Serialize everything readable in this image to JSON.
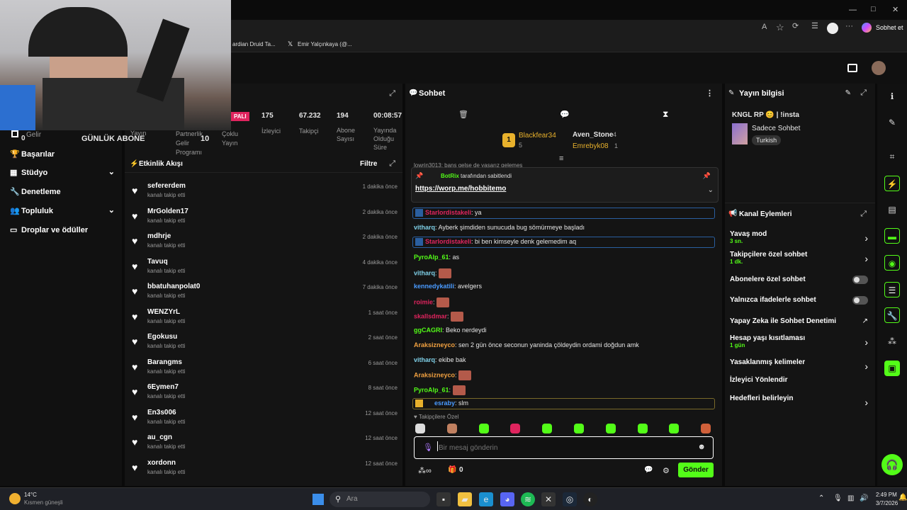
{
  "browser": {
    "window_controls": [
      "—",
      "□",
      "✕"
    ],
    "right_label": "Sobhet et",
    "bookmarks": [
      "ardian Druid Ta...",
      "Emir Yalçınkaya (@..."
    ]
  },
  "stats": {
    "badge": "PALI",
    "items": [
      {
        "value": "175",
        "label": "İzleyici"
      },
      {
        "value": "67.232",
        "label": "Takipçi"
      },
      {
        "value": "194",
        "label": "Abone Sayısı"
      },
      {
        "value": "00:08:57",
        "label": "Yayında Olduğu Süre"
      }
    ],
    "lower": {
      "gelir_zero": "0",
      "gelir_label": "Gelir",
      "yayin_label": "Yayın",
      "gunluk_abone": "GÜNLÜK ABONE",
      "partnerlik_label": "Partnerlik Gelir Programı",
      "partnerlik_value": "10",
      "coklu_label": "Çoklu Yayın"
    }
  },
  "nav": {
    "items": [
      {
        "label": "Başarılar",
        "icon": "trophy-icon"
      },
      {
        "label": "Stüdyo",
        "icon": "grid-icon",
        "chevron": true
      },
      {
        "label": "Denetleme",
        "icon": "wrench-icon"
      },
      {
        "label": "Topluluk",
        "icon": "people-icon",
        "chevron": true
      },
      {
        "label": "Droplar ve ödüller",
        "icon": "bars-icon"
      }
    ]
  },
  "events": {
    "title": "Etkinlik Akışı",
    "filter": "Filtre",
    "sub": "kanalı takip etti",
    "rows": [
      {
        "name": "sefererdem",
        "time": "1 dakika önce"
      },
      {
        "name": "MrGolden17",
        "time": "2 dakika önce"
      },
      {
        "name": "mdhrje",
        "time": "2 dakika önce"
      },
      {
        "name": "Tavuq",
        "time": "4 dakika önce"
      },
      {
        "name": "bbatuhanpolat0",
        "time": "7 dakika önce"
      },
      {
        "name": "WENZYrL",
        "time": "1 saat önce"
      },
      {
        "name": "Egokusu",
        "time": "2 saat önce"
      },
      {
        "name": "Barangms",
        "time": "6 saat önce"
      },
      {
        "name": "6Eymen7",
        "time": "8 saat önce"
      },
      {
        "name": "En3s006",
        "time": "12 saat önce"
      },
      {
        "name": "au_cgn",
        "time": "12 saat önce"
      },
      {
        "name": "xordonn",
        "time": "12 saat önce"
      }
    ]
  },
  "chat": {
    "title": "Sohbet",
    "top_users": [
      {
        "name": "Blackfear34",
        "count": "5",
        "color": "#e8b12c"
      },
      {
        "name": "Aven_Stone",
        "count": "4",
        "color": "#ffffff"
      },
      {
        "name": "Emrebyk08",
        "count": "1",
        "color": "#e8b12c"
      }
    ],
    "cut_line": "lowrin3013: banş gelse de yaşarız gelemes",
    "pinned": {
      "by": "BotRix",
      "by_suffix": "tarafından sabitlendi",
      "link": "https://worp.me/hobbitemo"
    },
    "messages": [
      {
        "user": "Starlordistakeli",
        "text": ": ya",
        "color": "#e0245e",
        "boxed": true
      },
      {
        "user": "vitharq",
        "text": ": Ayberk şimdiden sunucuda bug sömürmeye başladı",
        "color": "#7fd0e8"
      },
      {
        "user": "Starlordistakeli",
        "text": ": bi ben kimseyle denk gelemedim aq",
        "color": "#e0245e",
        "boxed": true
      },
      {
        "user": "PyroAlp_61",
        "text": ": as",
        "color": "#53fc18"
      },
      {
        "user": "vitharq",
        "text": ":",
        "color": "#7fd0e8",
        "emote": true
      },
      {
        "user": "kennedykatili",
        "text": ": avelgers",
        "color": "#4a9bff"
      },
      {
        "user": "roimie",
        "text": ":",
        "color": "#e0245e",
        "emote": true
      },
      {
        "user": "skallsdmar",
        "text": ":",
        "color": "#e0245e",
        "emote": true
      },
      {
        "user": "ggCAGRI",
        "text": ": Beko nerdeydi",
        "color": "#53fc18"
      },
      {
        "user": "Araksizneyco",
        "text": ": sen 2 gün önce seconun yaninda çöldeydin ordami doğdun amk",
        "color": "#f0a040"
      },
      {
        "user": "vitharq",
        "text": ": ekibe bak",
        "color": "#7fd0e8"
      },
      {
        "user": "Araksizneyco",
        "text": ":",
        "color": "#f0a040",
        "emote": true
      },
      {
        "user": "PyroAlp_61",
        "text": ":",
        "color": "#53fc18",
        "emote": true
      },
      {
        "user": "esraby",
        "text": ": slm",
        "color": "#4a9bff",
        "gold": true
      }
    ],
    "follower_only": "Takipçilere Özel",
    "input_placeholder": "Bir mesaj gönderin",
    "bottom_count": "0",
    "send": "Gönder"
  },
  "stream_info": {
    "title": "Yayın bilgisi",
    "stream_title": "KNGL RP 😊 | !insta",
    "category": "Sadece Sohbet",
    "tag": "Turkish"
  },
  "channel_actions": {
    "title": "Kanal Eylemleri",
    "items": [
      {
        "label": "Yavaş mod",
        "sub": "3 sn.",
        "kind": "chevron"
      },
      {
        "label": "Takipçilere özel sohbet",
        "sub": "1 dk.",
        "kind": "chevron"
      },
      {
        "label": "Abonelere özel sohbet",
        "sub": "",
        "kind": "toggle"
      },
      {
        "label": "Yalnızca ifadelerle sohbet",
        "sub": "",
        "kind": "toggle"
      },
      {
        "label": "Yapay Zeka ile Sohbet Denetimi",
        "sub": "",
        "kind": "external"
      },
      {
        "label": "Hesap yaşı kısıtlaması",
        "sub": "1 gün",
        "kind": "chevron"
      },
      {
        "label": "Yasaklanmış kelimeler",
        "sub": "",
        "kind": "chevron"
      },
      {
        "label": "İzleyici Yönlendir",
        "sub": "",
        "kind": "none"
      },
      {
        "label": "Hedefleri belirleyin",
        "sub": "",
        "kind": "chevron"
      }
    ]
  },
  "taskbar": {
    "weather_temp": "14°C",
    "weather_desc": "Kısmen güneşli",
    "search": "Ara",
    "time": "2:49 PM",
    "date": "3/7/2026"
  },
  "colors": {
    "accent": "#53fc18",
    "panel": "#141414"
  }
}
